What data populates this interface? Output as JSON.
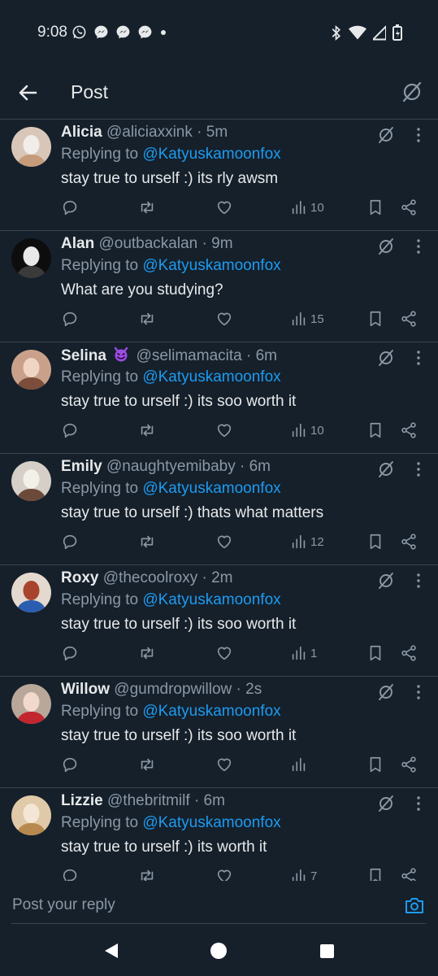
{
  "status_bar": {
    "time": "9:08"
  },
  "header": {
    "title": "Post"
  },
  "replies": [
    {
      "name": "Alicia",
      "handle": "@aliciaxxink",
      "time": "· 5m",
      "replying_prefix": "Replying to ",
      "replying_to": "@Katyuskamoonfox",
      "text": "stay true to urself :) its rly awsm",
      "views": "10",
      "avatar_colors": [
        "#d8c7b9",
        "#f2ede8",
        "#c59b7a"
      ]
    },
    {
      "name": "Alan",
      "handle": "@outbackalan",
      "time": "· 9m",
      "replying_prefix": "Replying to ",
      "replying_to": "@Katyuskamoonfox",
      "text": "What are you studying?",
      "views": "15",
      "avatar_colors": [
        "#0d0d0d",
        "#e8e8e8",
        "#3a3a3a"
      ]
    },
    {
      "name": "Selina",
      "handle": "@selimamacita",
      "time": "· 6m",
      "replying_prefix": "Replying to ",
      "replying_to": "@Katyuskamoonfox",
      "text": "stay true to urself :) its soo worth it",
      "views": "10",
      "emoji": "smiling-devil-emoji",
      "avatar_colors": [
        "#c9a18a",
        "#f0d5c4",
        "#7a4e3a"
      ]
    },
    {
      "name": "Emily",
      "handle": "@naughtyemibaby",
      "time": "· 6m",
      "replying_prefix": "Replying to ",
      "replying_to": "@Katyuskamoonfox",
      "text": "stay true to urself :) thats what matters",
      "views": "12",
      "avatar_colors": [
        "#d6cfc8",
        "#f3efe9",
        "#6b4a3a"
      ]
    },
    {
      "name": "Roxy",
      "handle": "@thecoolroxy",
      "time": "· 2m",
      "replying_prefix": "Replying to ",
      "replying_to": "@Katyuskamoonfox",
      "text": "stay true to urself :) its soo worth it",
      "views": "1",
      "avatar_colors": [
        "#e3d9cf",
        "#a8432e",
        "#2a5db0"
      ]
    },
    {
      "name": "Willow",
      "handle": "@gumdropwillow",
      "time": "· 2s",
      "replying_prefix": "Replying to ",
      "replying_to": "@Katyuskamoonfox",
      "text": "stay true to urself :) its soo worth it",
      "views": "",
      "avatar_colors": [
        "#b9a79a",
        "#f1d9cc",
        "#c2262e"
      ]
    },
    {
      "name": "Lizzie",
      "handle": "@thebritmilf",
      "time": "· 6m",
      "replying_prefix": "Replying to ",
      "replying_to": "@Katyuskamoonfox",
      "text": "stay true to urself :) its worth it",
      "views": "7",
      "avatar_colors": [
        "#e0c9a8",
        "#f4e6d4",
        "#b8894f"
      ]
    }
  ],
  "composer": {
    "placeholder": "Post your reply"
  },
  "colors": {
    "background": "#15202b",
    "accent": "#1d9bf0",
    "muted": "#8b98a5",
    "divider": "#38444d",
    "text": "#e7e9ea"
  }
}
